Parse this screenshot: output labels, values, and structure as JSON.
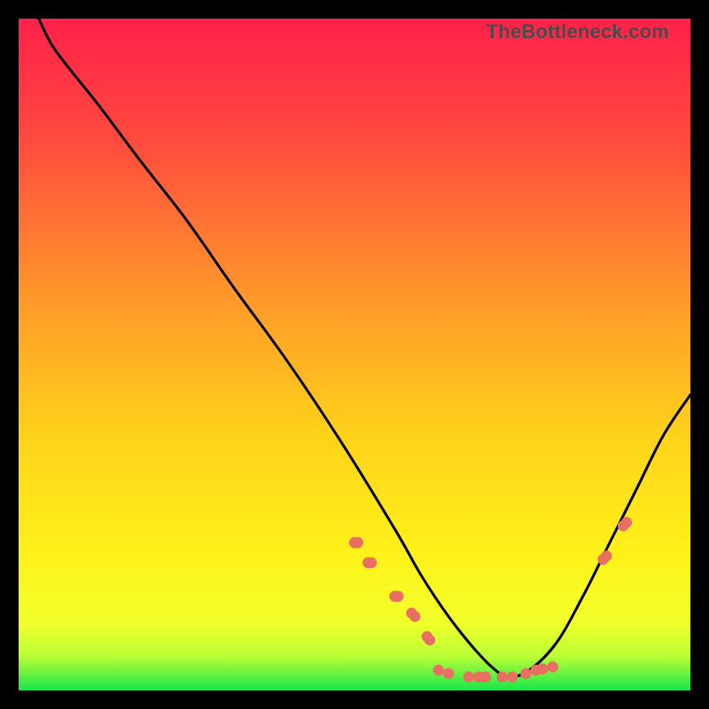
{
  "watermark": "TheBottleneck.com",
  "chart_data": {
    "type": "line",
    "title": "",
    "xlabel": "",
    "ylabel": "",
    "xlim": [
      0,
      100
    ],
    "ylim": [
      0,
      100
    ],
    "grid": false,
    "legend": false,
    "background_gradient": {
      "top": "#ff214a",
      "mid": "#ffd400",
      "green_band_top": "#f1ff2a",
      "green_band_bottom": "#17e64b"
    },
    "series": [
      {
        "name": "curve",
        "type": "line",
        "color": "#000000",
        "x": [
          3,
          5,
          8,
          12,
          18,
          25,
          32,
          40,
          48,
          56,
          60,
          64,
          68,
          71,
          73,
          76,
          80,
          84,
          88,
          92,
          96,
          100
        ],
        "y": [
          100,
          96,
          92,
          87,
          79,
          70,
          60,
          49,
          37,
          24,
          17,
          11,
          6,
          3,
          2,
          3,
          7,
          14,
          22,
          30,
          38,
          44
        ]
      },
      {
        "name": "markers-left",
        "type": "scatter",
        "color": "#e96f63",
        "x": [
          50.0,
          50.5,
          52.0,
          52.5,
          56.0,
          56.5,
          58.5,
          59.0,
          60.8,
          61.2
        ],
        "y": [
          22.0,
          22.0,
          19.0,
          19.0,
          14.0,
          14.0,
          11.5,
          11.0,
          8.0,
          7.5
        ]
      },
      {
        "name": "markers-bottom",
        "type": "scatter",
        "color": "#e96f63",
        "x": [
          62.5,
          64.0,
          67.0,
          68.5,
          69.5,
          72.0,
          73.5,
          75.5,
          77.0,
          78.0,
          79.5
        ],
        "y": [
          3.0,
          2.5,
          2.0,
          2.0,
          2.0,
          2.0,
          2.0,
          2.5,
          3.0,
          3.2,
          3.5
        ]
      },
      {
        "name": "markers-right",
        "type": "scatter",
        "color": "#e96f63",
        "x": [
          87.0,
          87.5,
          90.0,
          90.5
        ],
        "y": [
          19.5,
          20.0,
          24.5,
          25.0
        ]
      }
    ]
  }
}
